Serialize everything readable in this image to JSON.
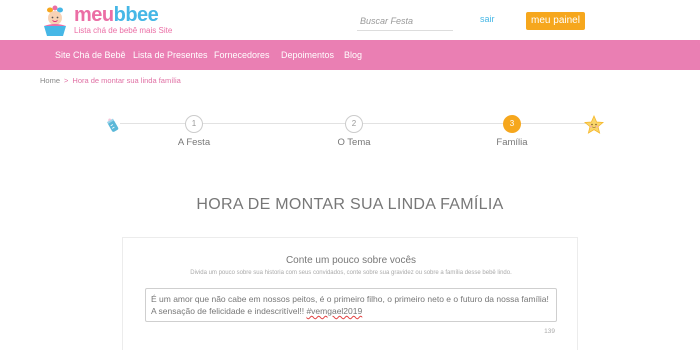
{
  "header": {
    "logo": {
      "word_part1": "meu",
      "word_part2": "bbee",
      "tagline": "Lista chá de bebê mais Site"
    },
    "search": {
      "placeholder": "Buscar Festa",
      "value": ""
    },
    "sair_label": "sair",
    "painel_label": "meu painel"
  },
  "nav": {
    "items": [
      {
        "label": "Site Chá de Bebê"
      },
      {
        "label": "Lista de Presentes"
      },
      {
        "label": "Fornecedores"
      },
      {
        "label": "Depoimentos"
      },
      {
        "label": "Blog"
      }
    ]
  },
  "breadcrumb": {
    "home": "Home",
    "separator": ">",
    "current": "Hora de montar sua linda família"
  },
  "stepper": {
    "steps": [
      {
        "number": "1",
        "label": "A Festa",
        "active": false
      },
      {
        "number": "2",
        "label": "O Tema",
        "active": false
      },
      {
        "number": "3",
        "label": "Família",
        "active": true
      }
    ]
  },
  "page_title": "HORA DE MONTAR SUA LINDA FAMÍLIA",
  "card": {
    "title": "Conte um pouco sobre vocês",
    "subtitle": "Divida um pouco sobre sua historia com seus convidados, conte sobre sua gravidez ou sobre a família desse bebê lindo.",
    "textarea_text": "É um amor que não cabe em nossos peitos, é o primeiro filho, o primeiro neto e o futuro da nossa família! A sensação de felicidade e indescritível!! ",
    "textarea_tag": "#vemgael2019",
    "char_count": "139"
  },
  "colors": {
    "pink": "#ea7fb3",
    "blue": "#46b7e6",
    "orange": "#f6a71d"
  }
}
